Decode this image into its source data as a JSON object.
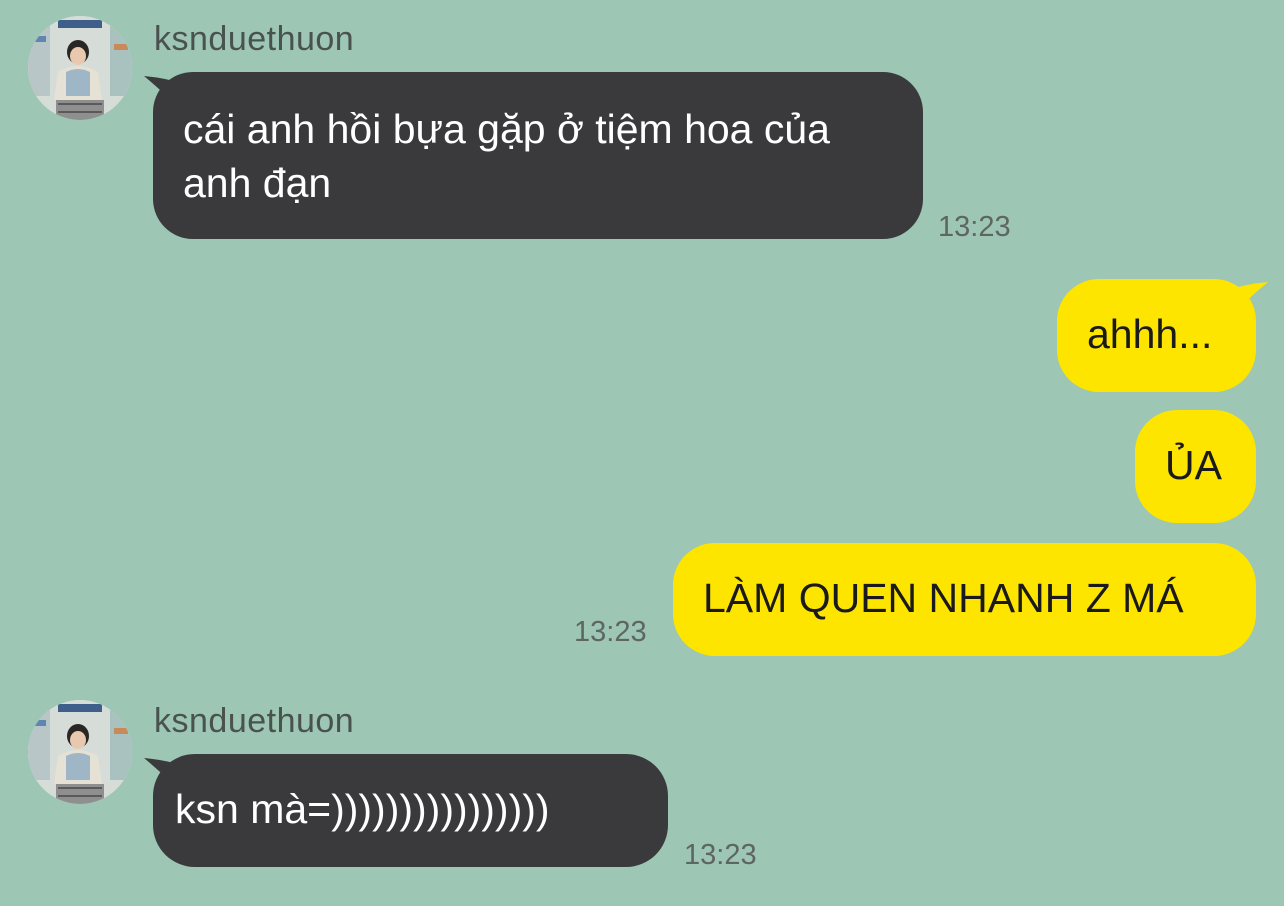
{
  "colors": {
    "background": "#9dc6b4",
    "incoming_bubble": "#3a3a3c",
    "outgoing_bubble": "#fee500"
  },
  "messages": {
    "group1": {
      "sender": "ksnduethuon",
      "text": "cái anh hồi bựa gặp ở tiệm hoa của anh đạn",
      "time": "13:23"
    },
    "group2": {
      "messages": [
        "ahhh...",
        "ỦA",
        "LÀM QUEN NHANH Z MÁ"
      ],
      "time": "13:23"
    },
    "group3": {
      "sender": "ksnduethuon",
      "text": "ksn mà=))))))))))))))))",
      "time": "13:23"
    }
  }
}
